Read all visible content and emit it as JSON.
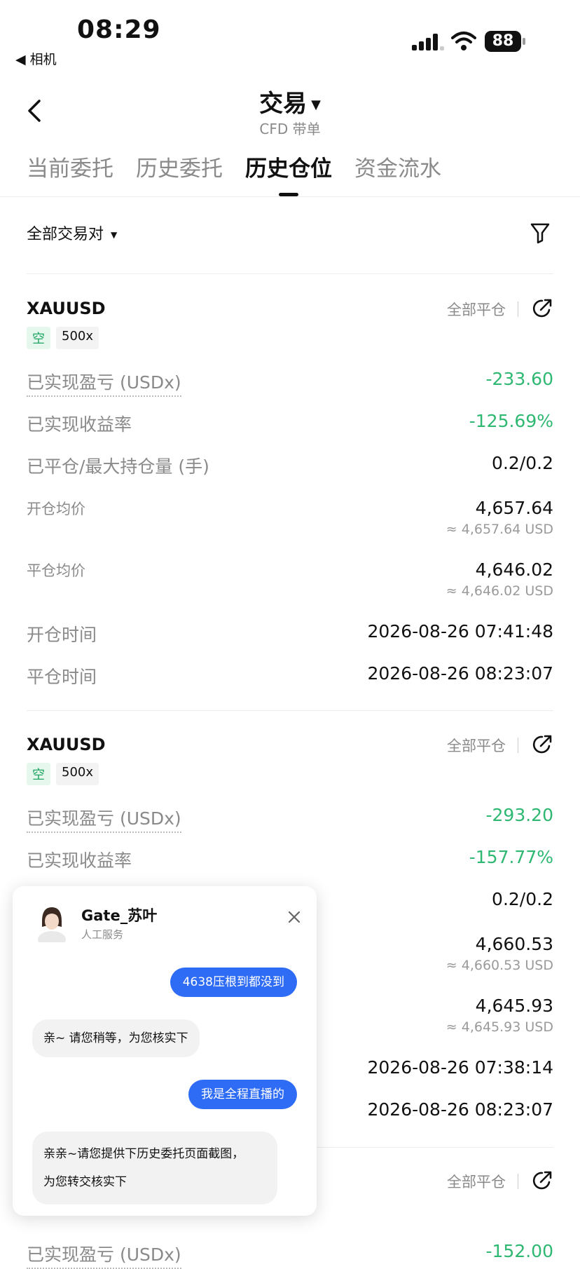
{
  "status_bar": {
    "time": "08:29",
    "back_app": "◀ 相机",
    "battery": "88"
  },
  "header": {
    "title": "交易",
    "subtitle": "CFD 带单"
  },
  "tabs": [
    {
      "label": "当前委托",
      "active": false
    },
    {
      "label": "历史委托",
      "active": false
    },
    {
      "label": "历史仓位",
      "active": true
    },
    {
      "label": "资金流水",
      "active": false
    }
  ],
  "filter": {
    "pair_label": "全部交易对"
  },
  "labels": {
    "realized_pnl": "已实现盈亏 (USDx)",
    "realized_rate": "已实现收益率",
    "closed_max": "已平仓/最大持仓量 (手)",
    "open_avg": "开仓均价",
    "close_avg": "平仓均价",
    "open_time": "开仓时间",
    "close_time": "平仓时间",
    "close_all": "全部平仓"
  },
  "positions": [
    {
      "symbol": "XAUUSD",
      "direction": "空",
      "leverage": "500x",
      "realized_pnl": "-233.60",
      "realized_rate": "-125.69%",
      "closed_max": "0.2/0.2",
      "open_avg": "4,657.64",
      "open_avg_usd": "≈ 4,657.64 USD",
      "close_avg": "4,646.02",
      "close_avg_usd": "≈ 4,646.02 USD",
      "open_time": "2026-08-26 07:41:48",
      "close_time": "2026-08-26 08:23:07"
    },
    {
      "symbol": "XAUUSD",
      "direction": "空",
      "leverage": "500x",
      "realized_pnl": "-293.20",
      "realized_rate": "-157.77%",
      "closed_max": "0.2/0.2",
      "open_avg": "4,660.53",
      "open_avg_usd": "≈ 4,660.53 USD",
      "close_avg": "4,645.93",
      "close_avg_usd": "≈ 4,645.93 USD",
      "open_time": "2026-08-26 07:38:14",
      "close_time": "2026-08-26 08:23:07"
    },
    {
      "realized_pnl": "-152.00"
    }
  ],
  "chat": {
    "agent_name": "Gate_苏叶",
    "agent_role": "人工服务",
    "messages": [
      {
        "from": "me",
        "text": "4638压根到都没到"
      },
      {
        "from": "agent",
        "text": "亲~ 请您稍等，为您核实下"
      },
      {
        "from": "me",
        "text": "我是全程直播的"
      },
      {
        "from": "agent",
        "line1": "亲亲~请您提供下历史委托页面截图，",
        "line2": "为您转交核实下"
      }
    ]
  },
  "colors": {
    "positive_green": "#2eb872",
    "accent_blue": "#2f6cf6",
    "muted_gray": "#8a8a8a"
  }
}
